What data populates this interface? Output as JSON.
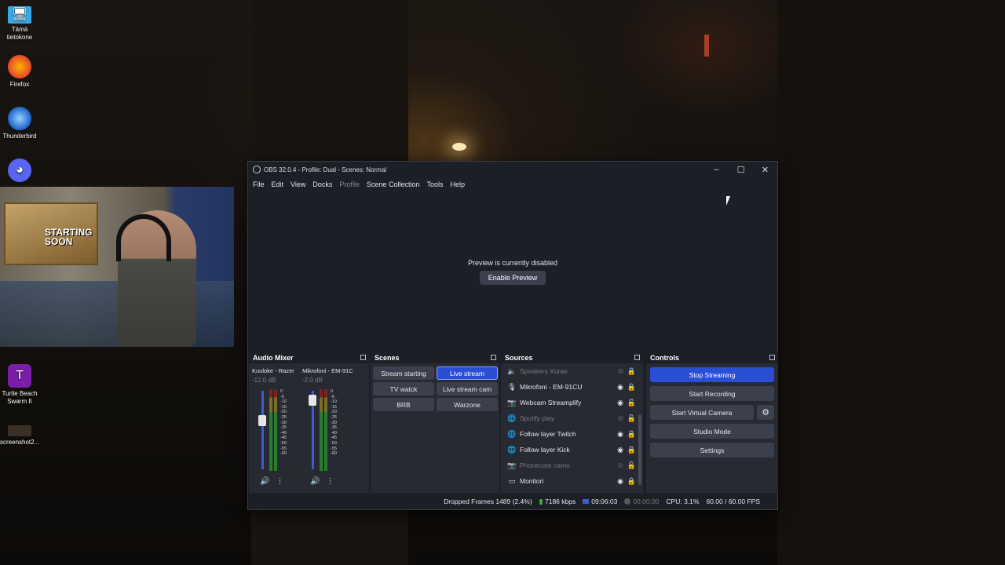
{
  "desktop": {
    "icons": [
      {
        "label": "Tämä\ntietokone",
        "line1": "Tämä",
        "line2": "tietokone",
        "icon": "computer-icon"
      },
      {
        "label": "Firefox",
        "icon": "firefox-icon"
      },
      {
        "label": "Thunderbird",
        "icon": "thunderbird-icon"
      },
      {
        "label": "Discord",
        "icon": "discord-icon"
      },
      {
        "label": "Turtle Beach Swarm II",
        "line1": "Turtle Beach",
        "line2": "Swarm II",
        "icon": "turtle-beach-icon"
      },
      {
        "label": "screenshot2...",
        "icon": "image-file-icon"
      }
    ],
    "webcam_poster_text": "STARTING SOON"
  },
  "window": {
    "title": "OBS 32.0.4 - Profile: Dual - Scenes: Normal",
    "menu": [
      "File",
      "Edit",
      "View",
      "Docks",
      "Profile",
      "Scene Collection",
      "Tools",
      "Help"
    ]
  },
  "preview": {
    "message": "Preview is currently disabled",
    "enable_label": "Enable Preview"
  },
  "audio_mixer": {
    "title": "Audio Mixer",
    "channels": [
      {
        "name": "Kuuloke - Razer",
        "db": "-12.0 dB",
        "level": 0.62
      },
      {
        "name": "Mikrofoni - EM-91C",
        "db": "-2.0 dB",
        "level": 0.88
      }
    ],
    "scale": [
      "0",
      "-5",
      "-10",
      "-15",
      "-20",
      "-25",
      "-30",
      "-35",
      "-40",
      "-45",
      "-50",
      "-55",
      "-60"
    ]
  },
  "scenes": {
    "title": "Scenes",
    "items": [
      {
        "label": "Stream starting",
        "active": false
      },
      {
        "label": "Live stream",
        "active": true
      },
      {
        "label": "TV watck",
        "active": false
      },
      {
        "label": "Live stream cam",
        "active": false
      },
      {
        "label": "BRB",
        "active": false
      },
      {
        "label": "Warzone",
        "active": false
      }
    ]
  },
  "sources": {
    "title": "Sources",
    "items": [
      {
        "label": "Speakers Xonar",
        "icon": "speaker-icon",
        "visible": false,
        "locked": true
      },
      {
        "label": "Mikrofoni - EM-91CU",
        "icon": "microphone-icon",
        "visible": true,
        "locked": true
      },
      {
        "label": "Webcam Streamplify",
        "icon": "camera-icon",
        "visible": true,
        "locked": false
      },
      {
        "label": "Spotify play",
        "icon": "globe-icon",
        "visible": false,
        "locked": false
      },
      {
        "label": "Follow layer Twitch",
        "icon": "globe-icon",
        "visible": true,
        "locked": true
      },
      {
        "label": "Follow layer Kick",
        "icon": "globe-icon",
        "visible": true,
        "locked": true
      },
      {
        "label": "Phonecam camo",
        "icon": "camera-icon",
        "visible": false,
        "locked": false
      },
      {
        "label": "Monitori",
        "icon": "monitor-icon",
        "visible": true,
        "locked": true
      }
    ]
  },
  "controls": {
    "title": "Controls",
    "stop_streaming": "Stop Streaming",
    "start_recording": "Start Recording",
    "start_virtual_camera": "Start Virtual Camera",
    "studio_mode": "Studio Mode",
    "settings": "Settings"
  },
  "status": {
    "dropped_frames": "Dropped Frames 1489 (2.4%)",
    "bitrate": "7186 kbps",
    "stream_time": "09:06:03",
    "record_time": "00:00:00",
    "cpu": "CPU: 3.1%",
    "fps": "60.00 / 60.00 FPS"
  },
  "colors": {
    "accent": "#2b4fd4",
    "panel": "#272a33",
    "window": "#1d1f26",
    "signal": "#35c335"
  }
}
